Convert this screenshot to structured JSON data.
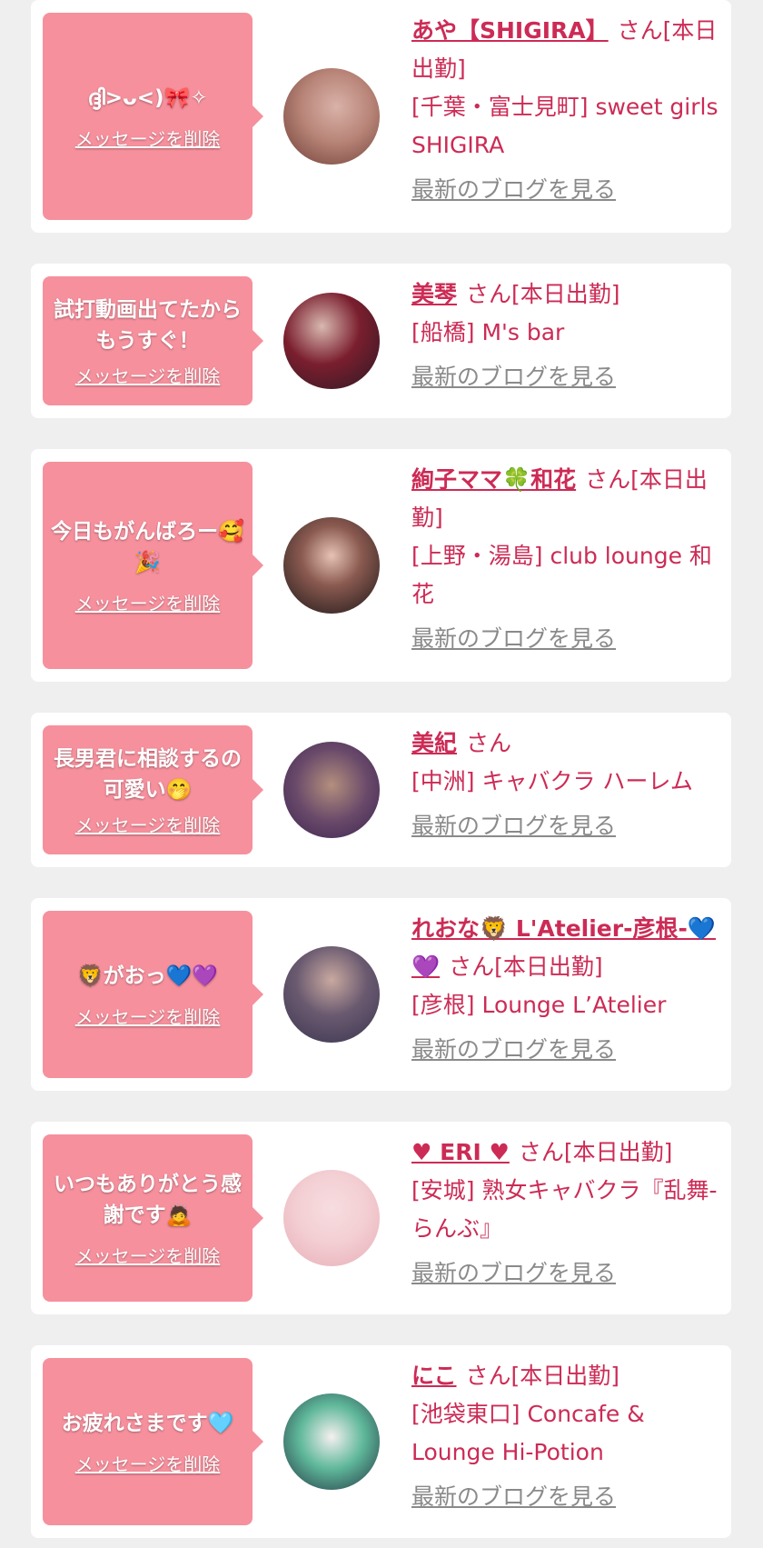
{
  "common": {
    "delete_label": "メッセージを削除",
    "blog_label": "最新のブログを見る"
  },
  "entries": [
    {
      "message": "ദ്ദി>ᴗ<)🎀✧",
      "name": "あや【SHIGIRA】",
      "suffix": "さん[本日出勤]",
      "store": "[千葉・富士見町] sweet girls SHIGIRA",
      "avatar_colors": [
        "#d9b2a8",
        "#6b3b32"
      ]
    },
    {
      "message": "試打動画出てたからもうすぐ！",
      "name": "美琴",
      "suffix": "さん[本日出勤]",
      "store": "[船橋] M's bar",
      "avatar_colors": [
        "#7a1e2e",
        "#2b1a25"
      ]
    },
    {
      "message": "今日もがんばろー🥰🎉",
      "name": "絢子ママ🍀和花",
      "suffix": "さん[本日出勤]",
      "store": "[上野・湯島] club lounge 和花",
      "avatar_colors": [
        "#e6c2b5",
        "#1c1618"
      ]
    },
    {
      "message": "長男君に相談するの可愛い🤭",
      "name": "美紀",
      "suffix": "さん",
      "store": "[中洲] キャバクラ ハーレム",
      "avatar_colors": [
        "#b38f7d",
        "#3b2350"
      ]
    },
    {
      "message": "🦁がおっ💙💜",
      "name": "れおな🦁 L'Atelier-彦根-💙💜",
      "suffix": "さん[本日出勤]",
      "store": "[彦根] Lounge L’Atelier",
      "avatar_colors": [
        "#c9a9a0",
        "#3a3550"
      ]
    },
    {
      "message": "いつもありがとう感謝です🙇",
      "name": "♥ ERI ♥",
      "suffix": "さん[本日出勤]",
      "store": "[安城] 熟女キャバクラ『乱舞-らんぶ』",
      "avatar_colors": [
        "#f3cfd3",
        "#e7aeb7"
      ]
    },
    {
      "message": "お疲れさまです🩵",
      "name": "にこ",
      "suffix": "さん[本日出勤]",
      "store": "[池袋東口] Concafe & Lounge Hi-Potion",
      "avatar_colors": [
        "#5fb89a",
        "#203040"
      ]
    }
  ]
}
